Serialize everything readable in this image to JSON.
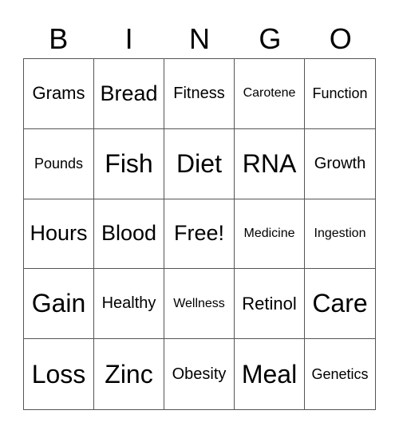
{
  "header": [
    "B",
    "I",
    "N",
    "G",
    "O"
  ],
  "cells": [
    {
      "text": "Grams",
      "size": "s3"
    },
    {
      "text": "Bread",
      "size": "s2"
    },
    {
      "text": "Fitness",
      "size": "s4"
    },
    {
      "text": "Carotene",
      "size": "s6"
    },
    {
      "text": "Function",
      "size": "s5"
    },
    {
      "text": "Pounds",
      "size": "s5"
    },
    {
      "text": "Fish",
      "size": "s1"
    },
    {
      "text": "Diet",
      "size": "s1"
    },
    {
      "text": "RNA",
      "size": "s1"
    },
    {
      "text": "Growth",
      "size": "s4"
    },
    {
      "text": "Hours",
      "size": "s2"
    },
    {
      "text": "Blood",
      "size": "s2"
    },
    {
      "text": "Free!",
      "size": "s2"
    },
    {
      "text": "Medicine",
      "size": "s6"
    },
    {
      "text": "Ingestion",
      "size": "s6"
    },
    {
      "text": "Gain",
      "size": "s1"
    },
    {
      "text": "Healthy",
      "size": "s4"
    },
    {
      "text": "Wellness",
      "size": "s6"
    },
    {
      "text": "Retinol",
      "size": "s3"
    },
    {
      "text": "Care",
      "size": "s1"
    },
    {
      "text": "Loss",
      "size": "s1"
    },
    {
      "text": "Zinc",
      "size": "s1"
    },
    {
      "text": "Obesity",
      "size": "s4"
    },
    {
      "text": "Meal",
      "size": "s1"
    },
    {
      "text": "Genetics",
      "size": "s5"
    }
  ]
}
